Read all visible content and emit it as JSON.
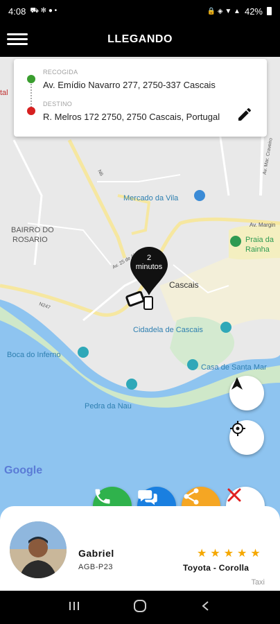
{
  "status_bar": {
    "time": "4:08",
    "battery": "42%"
  },
  "header": {
    "title": "LLEGANDO"
  },
  "route": {
    "pickup_label": "RECOGIDA",
    "pickup_address": "Av. Emídio Navarro 277, 2750-337 Cascais",
    "dest_label": "DESTINO",
    "dest_address": "R. Melros 172 2750, 2750 Cascais, Portugal"
  },
  "eta": {
    "value": "2",
    "unit": "minutos"
  },
  "map": {
    "labels": {
      "bairro": "BAIRRO DO",
      "rosario": "ROSARIO",
      "mercado": "Mercado da Vila",
      "praia": "Praia da",
      "rainha": "Rainha",
      "cascais": "Cascais",
      "cidadela": "Cidadela de Cascais",
      "boca": "Boca do Inferno",
      "casa": "Casa de Santa Mar",
      "pedra": "Pedra da Nau",
      "av_margin": "Av. Margin",
      "av_25": "Av. 25 de Abril",
      "n247": "N247",
      "n6": "N6",
      "av_mar": "Av. Mar. Craveiro",
      "google": "Google",
      "edge_tal": "tal"
    }
  },
  "driver": {
    "name": "Gabriel",
    "plate": "AGB-P23",
    "rating": 5,
    "vehicle": "Toyota - Corolla",
    "type": "Taxi"
  },
  "colors": {
    "call": "#2fb24c",
    "chat": "#1a7fe0",
    "share": "#f5a623",
    "cancel_icon": "#e02020",
    "star": "#f5a800"
  }
}
